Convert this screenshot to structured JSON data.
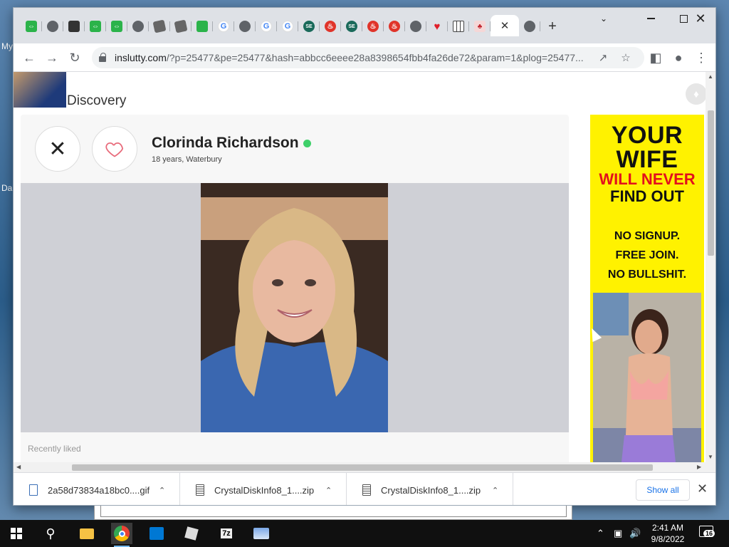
{
  "desktop": {
    "labels": [
      "My",
      "Da"
    ]
  },
  "browser": {
    "tabs": [
      {
        "icon": "link-green-icon"
      },
      {
        "icon": "globe-icon"
      },
      {
        "icon": "calculator-icon"
      },
      {
        "icon": "link-green-icon"
      },
      {
        "icon": "link-green-icon"
      },
      {
        "icon": "globe-icon"
      },
      {
        "icon": "roblox-icon"
      },
      {
        "icon": "roblox-icon"
      },
      {
        "icon": "bird-icon"
      },
      {
        "icon": "google-icon"
      },
      {
        "icon": "globe-icon"
      },
      {
        "icon": "google-icon"
      },
      {
        "icon": "google-icon"
      },
      {
        "icon": "se-icon"
      },
      {
        "icon": "fire-icon"
      },
      {
        "icon": "se-icon"
      },
      {
        "icon": "fire-icon"
      },
      {
        "icon": "fire-icon"
      },
      {
        "icon": "globe-icon"
      },
      {
        "icon": "heart-icon"
      },
      {
        "icon": "grid-icon"
      }
    ],
    "active_tab": {
      "icon": "chameleon-icon",
      "close": "✕"
    },
    "after_tab": {
      "icon": "globe-icon"
    },
    "new_tab": "+",
    "url_host": "inslutty.com",
    "url_rest": "/?p=25477&pe=25477&hash=abbcc6eeee28a8398654fbb4fa26de72&param=1&plog=25477..."
  },
  "page": {
    "brand": "Discovery",
    "profile": {
      "name": "Clorinda Richardson",
      "meta": "18 years, Waterbury",
      "online": true
    },
    "dislike_label": "✕",
    "recently_liked": "Recently liked"
  },
  "ad": {
    "line1": "YOUR",
    "line2": "WIFE",
    "line3": "WILL NEVER",
    "line4": "FIND OUT",
    "bullets": [
      "NO SIGNUP.",
      "FREE JOIN.",
      "NO BULLSHIT."
    ]
  },
  "downloads": {
    "items": [
      {
        "name": "2a58d73834a18bc0....gif",
        "type": "gif"
      },
      {
        "name": "CrystalDiskInfo8_1....zip",
        "type": "zip"
      },
      {
        "name": "CrystalDiskInfo8_1....zip",
        "type": "zip"
      }
    ],
    "show_all": "Show all"
  },
  "taskbar": {
    "time": "2:41 AM",
    "date": "9/8/2022",
    "notifications": "16",
    "apps": [
      "start",
      "search",
      "file-explorer",
      "chrome",
      "store",
      "roblox",
      "7zip",
      "app"
    ]
  },
  "colors": {
    "ad_yellow": "#fff200",
    "ad_red": "#e3101c",
    "online_green": "#3fd06a",
    "link_blue": "#1a73e8"
  }
}
